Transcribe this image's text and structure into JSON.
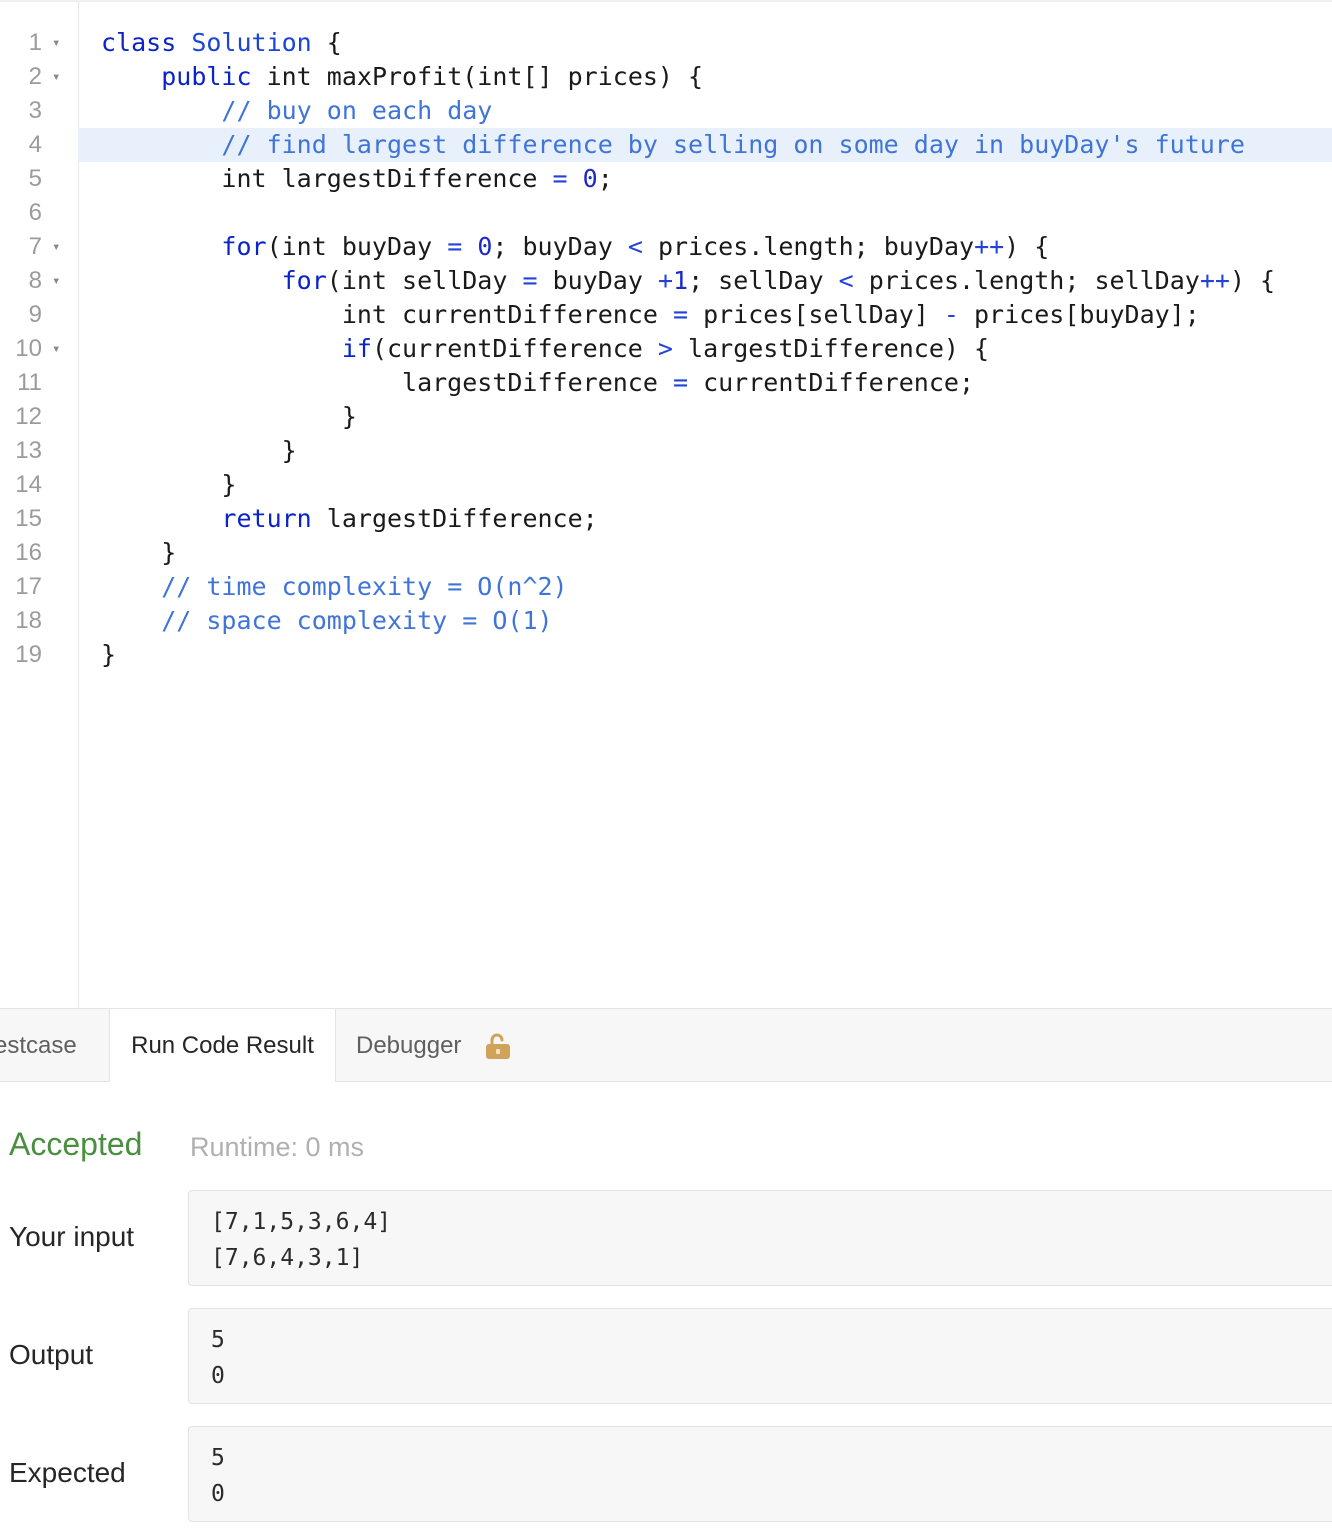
{
  "editor": {
    "lines": [
      {
        "num": "1",
        "fold": "▾",
        "tokens": [
          [
            "kw",
            "class"
          ],
          [
            "p",
            " "
          ],
          [
            "cls",
            "Solution"
          ],
          [
            "p",
            " {"
          ]
        ]
      },
      {
        "num": "2",
        "fold": "▾",
        "tokens": [
          [
            "p",
            "    "
          ],
          [
            "kw",
            "public"
          ],
          [
            "p",
            " int maxProfit(int[] prices) {"
          ]
        ]
      },
      {
        "num": "3",
        "fold": "",
        "tokens": [
          [
            "p",
            "        "
          ],
          [
            "cm",
            "// buy on each day"
          ]
        ]
      },
      {
        "num": "4",
        "fold": "",
        "tokens": [
          [
            "p",
            "        "
          ],
          [
            "cm",
            "// find largest difference by selling on some day in buyDay's future"
          ]
        ]
      },
      {
        "num": "5",
        "fold": "",
        "tokens": [
          [
            "p",
            "        int largestDifference "
          ],
          [
            "op",
            "="
          ],
          [
            "p",
            " "
          ],
          [
            "num",
            "0"
          ],
          [
            "p",
            ";"
          ]
        ]
      },
      {
        "num": "6",
        "fold": "",
        "tokens": []
      },
      {
        "num": "7",
        "fold": "▾",
        "tokens": [
          [
            "p",
            "        "
          ],
          [
            "kw",
            "for"
          ],
          [
            "p",
            "(int buyDay "
          ],
          [
            "op",
            "="
          ],
          [
            "p",
            " "
          ],
          [
            "num",
            "0"
          ],
          [
            "p",
            "; buyDay "
          ],
          [
            "op",
            "<"
          ],
          [
            "p",
            " prices.length; buyDay"
          ],
          [
            "op",
            "++"
          ],
          [
            "p",
            ") {"
          ]
        ]
      },
      {
        "num": "8",
        "fold": "▾",
        "tokens": [
          [
            "p",
            "            "
          ],
          [
            "kw",
            "for"
          ],
          [
            "p",
            "(int sellDay "
          ],
          [
            "op",
            "="
          ],
          [
            "p",
            " buyDay "
          ],
          [
            "op",
            "+"
          ],
          [
            "num",
            "1"
          ],
          [
            "p",
            "; sellDay "
          ],
          [
            "op",
            "<"
          ],
          [
            "p",
            " prices.length; sellDay"
          ],
          [
            "op",
            "++"
          ],
          [
            "p",
            ") {"
          ]
        ]
      },
      {
        "num": "9",
        "fold": "",
        "tokens": [
          [
            "p",
            "                int currentDifference "
          ],
          [
            "op",
            "="
          ],
          [
            "p",
            " prices[sellDay] "
          ],
          [
            "op",
            "-"
          ],
          [
            "p",
            " prices[buyDay];"
          ]
        ]
      },
      {
        "num": "10",
        "fold": "▾",
        "tokens": [
          [
            "p",
            "                "
          ],
          [
            "kw",
            "if"
          ],
          [
            "p",
            "(currentDifference "
          ],
          [
            "op",
            ">"
          ],
          [
            "p",
            " largestDifference) {"
          ]
        ]
      },
      {
        "num": "11",
        "fold": "",
        "tokens": [
          [
            "p",
            "                    largestDifference "
          ],
          [
            "op",
            "="
          ],
          [
            "p",
            " currentDifference;"
          ]
        ]
      },
      {
        "num": "12",
        "fold": "",
        "tokens": [
          [
            "p",
            "                }"
          ]
        ]
      },
      {
        "num": "13",
        "fold": "",
        "tokens": [
          [
            "p",
            "            }"
          ]
        ]
      },
      {
        "num": "14",
        "fold": "",
        "tokens": [
          [
            "p",
            "        }"
          ]
        ]
      },
      {
        "num": "15",
        "fold": "",
        "tokens": [
          [
            "p",
            "        "
          ],
          [
            "kw",
            "return"
          ],
          [
            "p",
            " largestDifference;"
          ]
        ]
      },
      {
        "num": "16",
        "fold": "",
        "tokens": [
          [
            "p",
            "    }"
          ]
        ]
      },
      {
        "num": "17",
        "fold": "",
        "tokens": [
          [
            "p",
            "    "
          ],
          [
            "cm",
            "// time complexity = O(n^2)"
          ]
        ]
      },
      {
        "num": "18",
        "fold": "",
        "tokens": [
          [
            "p",
            "    "
          ],
          [
            "cm",
            "// space complexity = O(1)"
          ]
        ]
      },
      {
        "num": "19",
        "fold": "",
        "tokens": [
          [
            "p",
            "}"
          ]
        ]
      }
    ],
    "active_line": 4
  },
  "tabs": {
    "testcase": "estcase",
    "result": "Run Code Result",
    "debugger": "Debugger"
  },
  "result": {
    "status": "Accepted",
    "runtime": "Runtime: 0 ms",
    "status_color": "#4a8f3f",
    "your_input_label": "Your input",
    "your_input": [
      "[7,1,5,3,6,4]",
      "[7,6,4,3,1]"
    ],
    "output_label": "Output",
    "output": [
      "5",
      "0"
    ],
    "expected_label": "Expected",
    "expected": [
      "5",
      "0"
    ]
  },
  "icons": {
    "debugger_lock": "unlock-icon"
  }
}
